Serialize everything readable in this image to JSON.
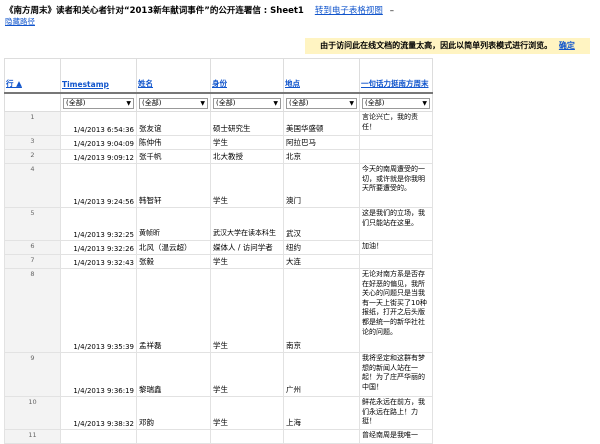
{
  "header": {
    "title": "《南方周末》读者和关心者针对“2013新年献词事件”的公开连署信 : Sheet1",
    "switch_link": "转到电子表格视图",
    "dash": "–",
    "hide_path": "隐藏路径"
  },
  "notice": {
    "text": "由于访问此在线文档的流量太高，因此以简单列表模式进行浏览。",
    "confirm": "确定"
  },
  "columns": {
    "row": "行 ▲",
    "timestamp": "Timestamp",
    "name": "姓名",
    "identity": "身份",
    "location": "地点",
    "comment": "一句话力挺南方周末"
  },
  "filter": {
    "all": "(全部)",
    "arrow": "▼"
  },
  "rows": [
    {
      "n": "1",
      "ts": "1/4/2013 6:54:36",
      "name": "张友谊",
      "id": "硕士研究生",
      "loc": "美国华盛顿",
      "c": "言论兴亡，我的责任！"
    },
    {
      "n": "3",
      "ts": "1/4/2013 9:04:09",
      "name": "陈仲伟",
      "id": "学生",
      "loc": "阿拉巴马",
      "c": ""
    },
    {
      "n": "2",
      "ts": "1/4/2013 9:09:12",
      "name": "张千帆",
      "id": "北大教授",
      "loc": "北京",
      "c": ""
    },
    {
      "n": "4",
      "ts": "1/4/2013 9:24:56",
      "name": "韩智轩",
      "id": "学生",
      "loc": "澳门",
      "c": "今天的南周遭受的一切，或许就是你我明天所要遭受的。"
    },
    {
      "n": "5",
      "ts": "1/4/2013 9:32:25",
      "name": "黄帧昕",
      "id": "武汉大学在读本科生",
      "loc": "武汉",
      "c": "这是我们的立场，我们只能站在这里。"
    },
    {
      "n": "6",
      "ts": "1/4/2013 9:32:26",
      "name": "北风（温云超）",
      "id": "媒体人 / 访问学者",
      "loc": "纽约",
      "c": "加油！"
    },
    {
      "n": "7",
      "ts": "1/4/2013 9:32:43",
      "name": "张毅",
      "id": "学生",
      "loc": "大连",
      "c": ""
    },
    {
      "n": "8",
      "ts": "1/4/2013 9:35:39",
      "name": "孟祥磊",
      "id": "学生",
      "loc": "南京",
      "c": "无论对南方系是否存在好恶的偏见，我所关心的问题只是当我有一天上街买了10种报纸，打开之后头版都是统一的新华社社论的问题。"
    },
    {
      "n": "9",
      "ts": "1/4/2013 9:36:19",
      "name": "黎瑞鑫",
      "id": "学生",
      "loc": "广州",
      "c": "我将坚定和这群有梦想的新闻人站在一起！为了庄严华丽的中国！"
    },
    {
      "n": "10",
      "ts": "1/4/2013 9:38:32",
      "name": "邓韵",
      "id": "学生",
      "loc": "上海",
      "c": "鲜花永远在前方，我们永远在路上！力挺！"
    },
    {
      "n": "11",
      "ts": "",
      "name": "",
      "id": "",
      "loc": "",
      "c": "曾经南周是我唯一"
    }
  ]
}
